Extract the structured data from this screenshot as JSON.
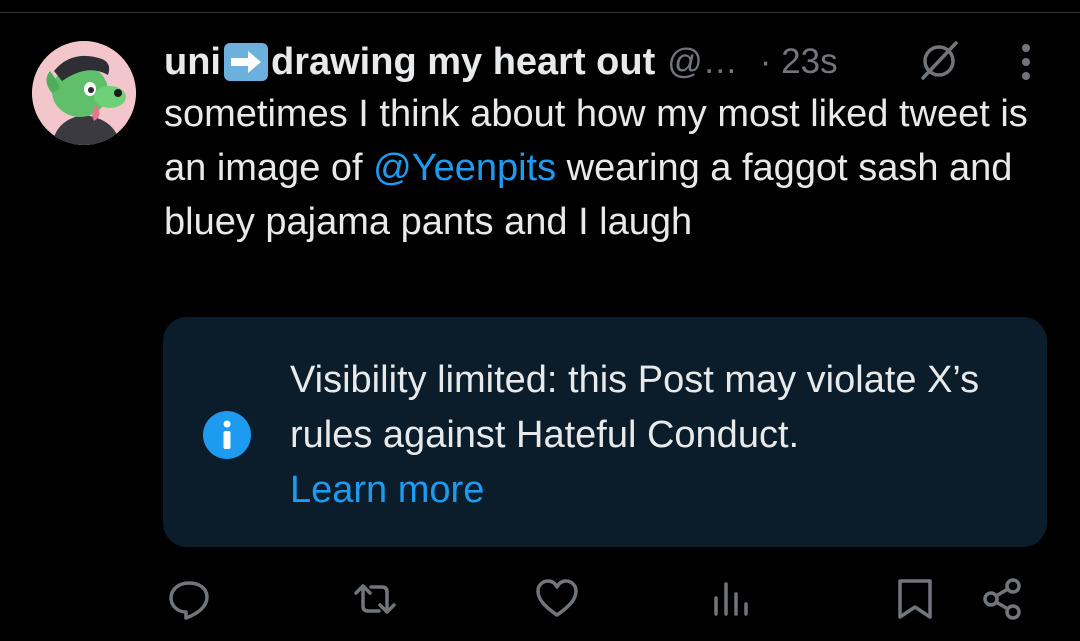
{
  "post": {
    "display_name_part1": "uni",
    "display_name_part2": "drawing my heart out",
    "name_emoji_icon": "right-arrow-emoji-icon",
    "handle": "@…",
    "time": "· 23s",
    "text_part1": "sometimes I think about how my most liked tweet is an image of ",
    "mention": "@Yeenpits",
    "text_part2": " wearing a faggot sash and bluey pajama pants and I laugh"
  },
  "notice": {
    "icon": "info-icon",
    "message": "Visibility limited: this Post may violate X’s rules against Hateful Conduct.",
    "link": "Learn more"
  },
  "actions": {
    "icons": [
      "reply-icon",
      "repost-icon",
      "like-icon",
      "views-icon",
      "bookmark-icon",
      "share-icon"
    ]
  },
  "colors": {
    "background": "#000000",
    "text": "#e7e9ea",
    "muted": "#71767b",
    "accent": "#1d9bf0",
    "notice_background": "#0b1d2a"
  }
}
